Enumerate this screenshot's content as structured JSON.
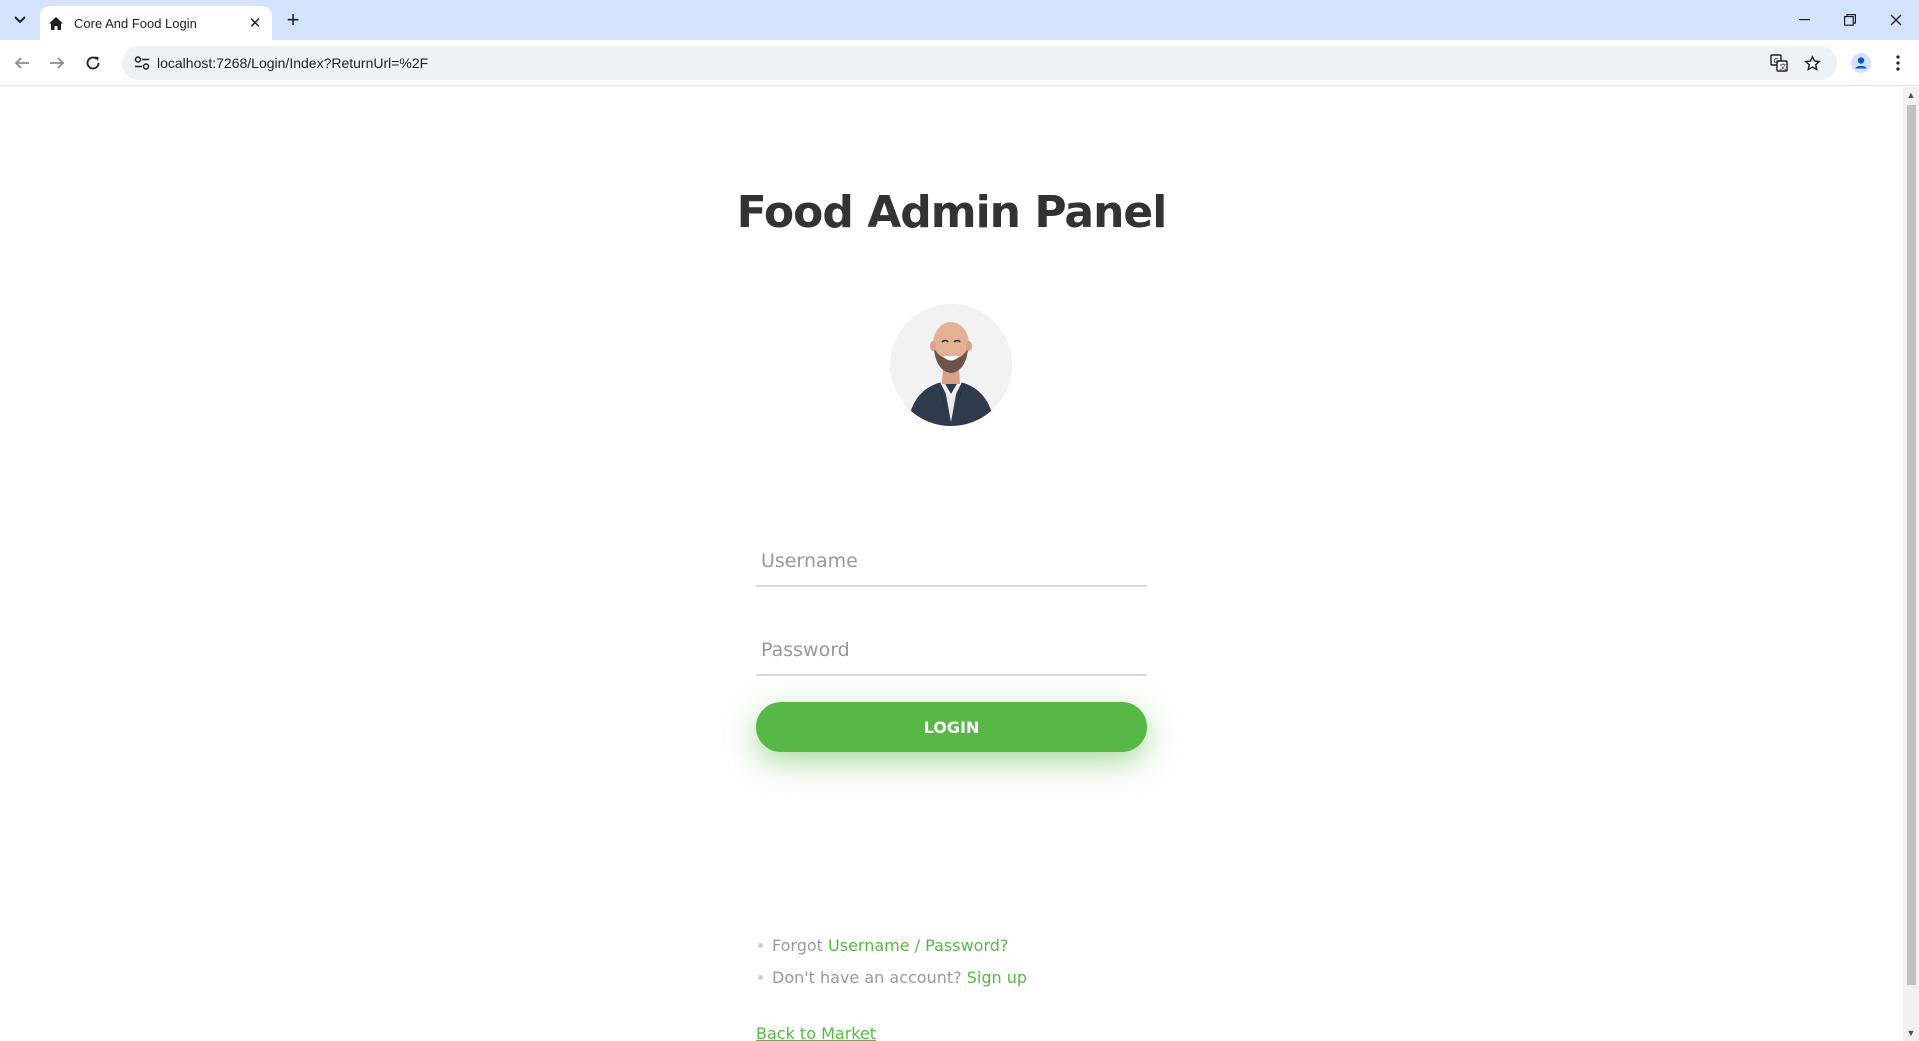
{
  "browser": {
    "tab_title": "Core And Food Login",
    "url": "localhost:7268/Login/Index?ReturnUrl=%2F",
    "tab_icon": "home-icon"
  },
  "page": {
    "title": "Food Admin Panel",
    "username_placeholder": "Username",
    "password_placeholder": "Password",
    "login_label": "LOGIN",
    "forgot_prefix": "Forgot",
    "forgot_link": "Username / Password?",
    "signup_prefix": "Don't have an account?",
    "signup_link": "Sign up",
    "back_link": "Back to Market"
  },
  "colors": {
    "accent": "#57b846",
    "title": "#333333",
    "tabbar": "#d3e3fd"
  }
}
